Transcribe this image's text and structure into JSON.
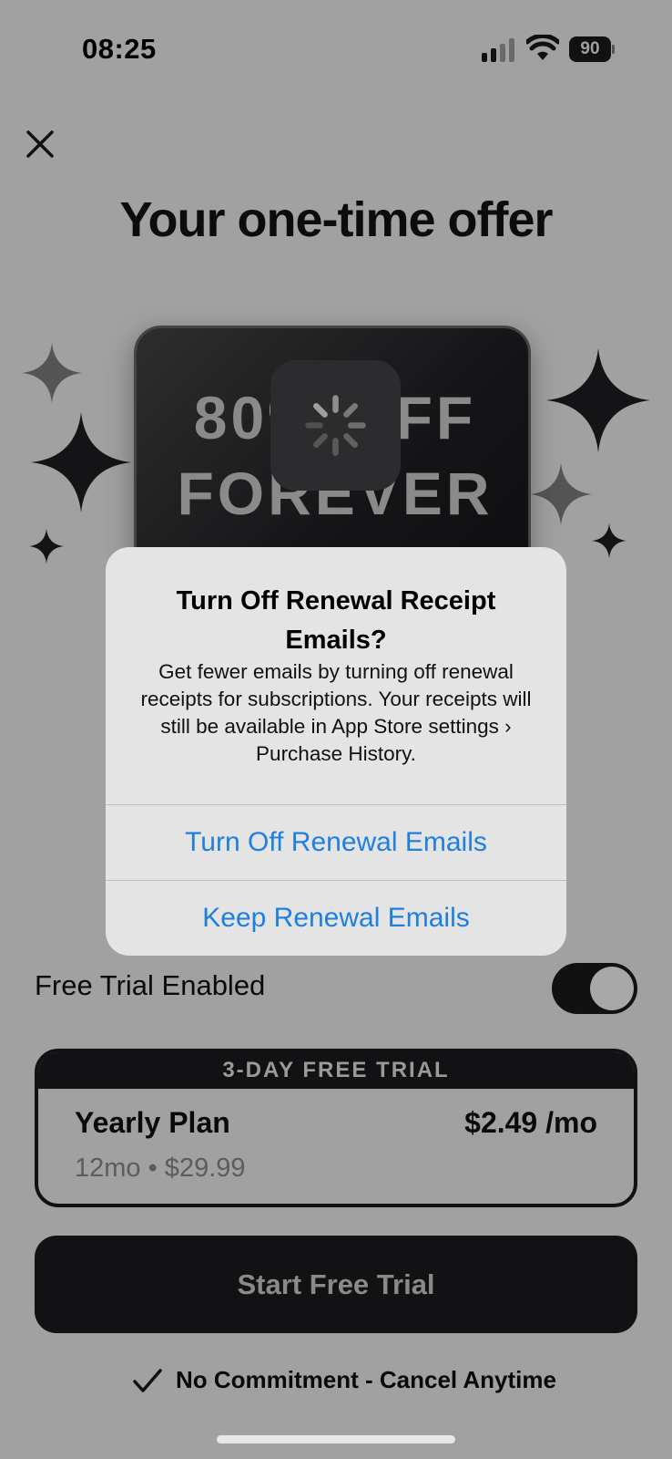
{
  "status_bar": {
    "time": "08:25",
    "battery": "90",
    "icons": [
      "cellular-signal-icon",
      "wifi-icon",
      "battery-icon"
    ]
  },
  "header": {
    "close_icon": "close-icon",
    "title": "Your one-time offer"
  },
  "offer_card": {
    "line1": "80% OFF",
    "line2": "FOREVER",
    "loading_icon": "activity-spinner-icon"
  },
  "alert": {
    "title": "Turn Off Renewal Receipt Emails?",
    "message": "Get fewer emails by turning off renewal receipts for subscriptions. Your receipts will still be available in App Store settings › Purchase History.",
    "primary_button": "Turn Off Renewal Emails",
    "secondary_button": "Keep Renewal Emails"
  },
  "free_trial": {
    "label": "Free Trial Enabled",
    "enabled": true
  },
  "plan": {
    "banner": "3-DAY FREE TRIAL",
    "name": "Yearly Plan",
    "price": "$2.49 /mo",
    "details": "12mo • $29.99"
  },
  "cta": {
    "label": "Start Free Trial"
  },
  "footer": {
    "commitment": "No Commitment - Cancel Anytime",
    "check_icon": "checkmark-icon"
  },
  "colors": {
    "overlay_background": "#a1a1a1",
    "dark": "#121214",
    "alert_background": "#e4e4e4",
    "link_blue": "#1f7fe0"
  }
}
